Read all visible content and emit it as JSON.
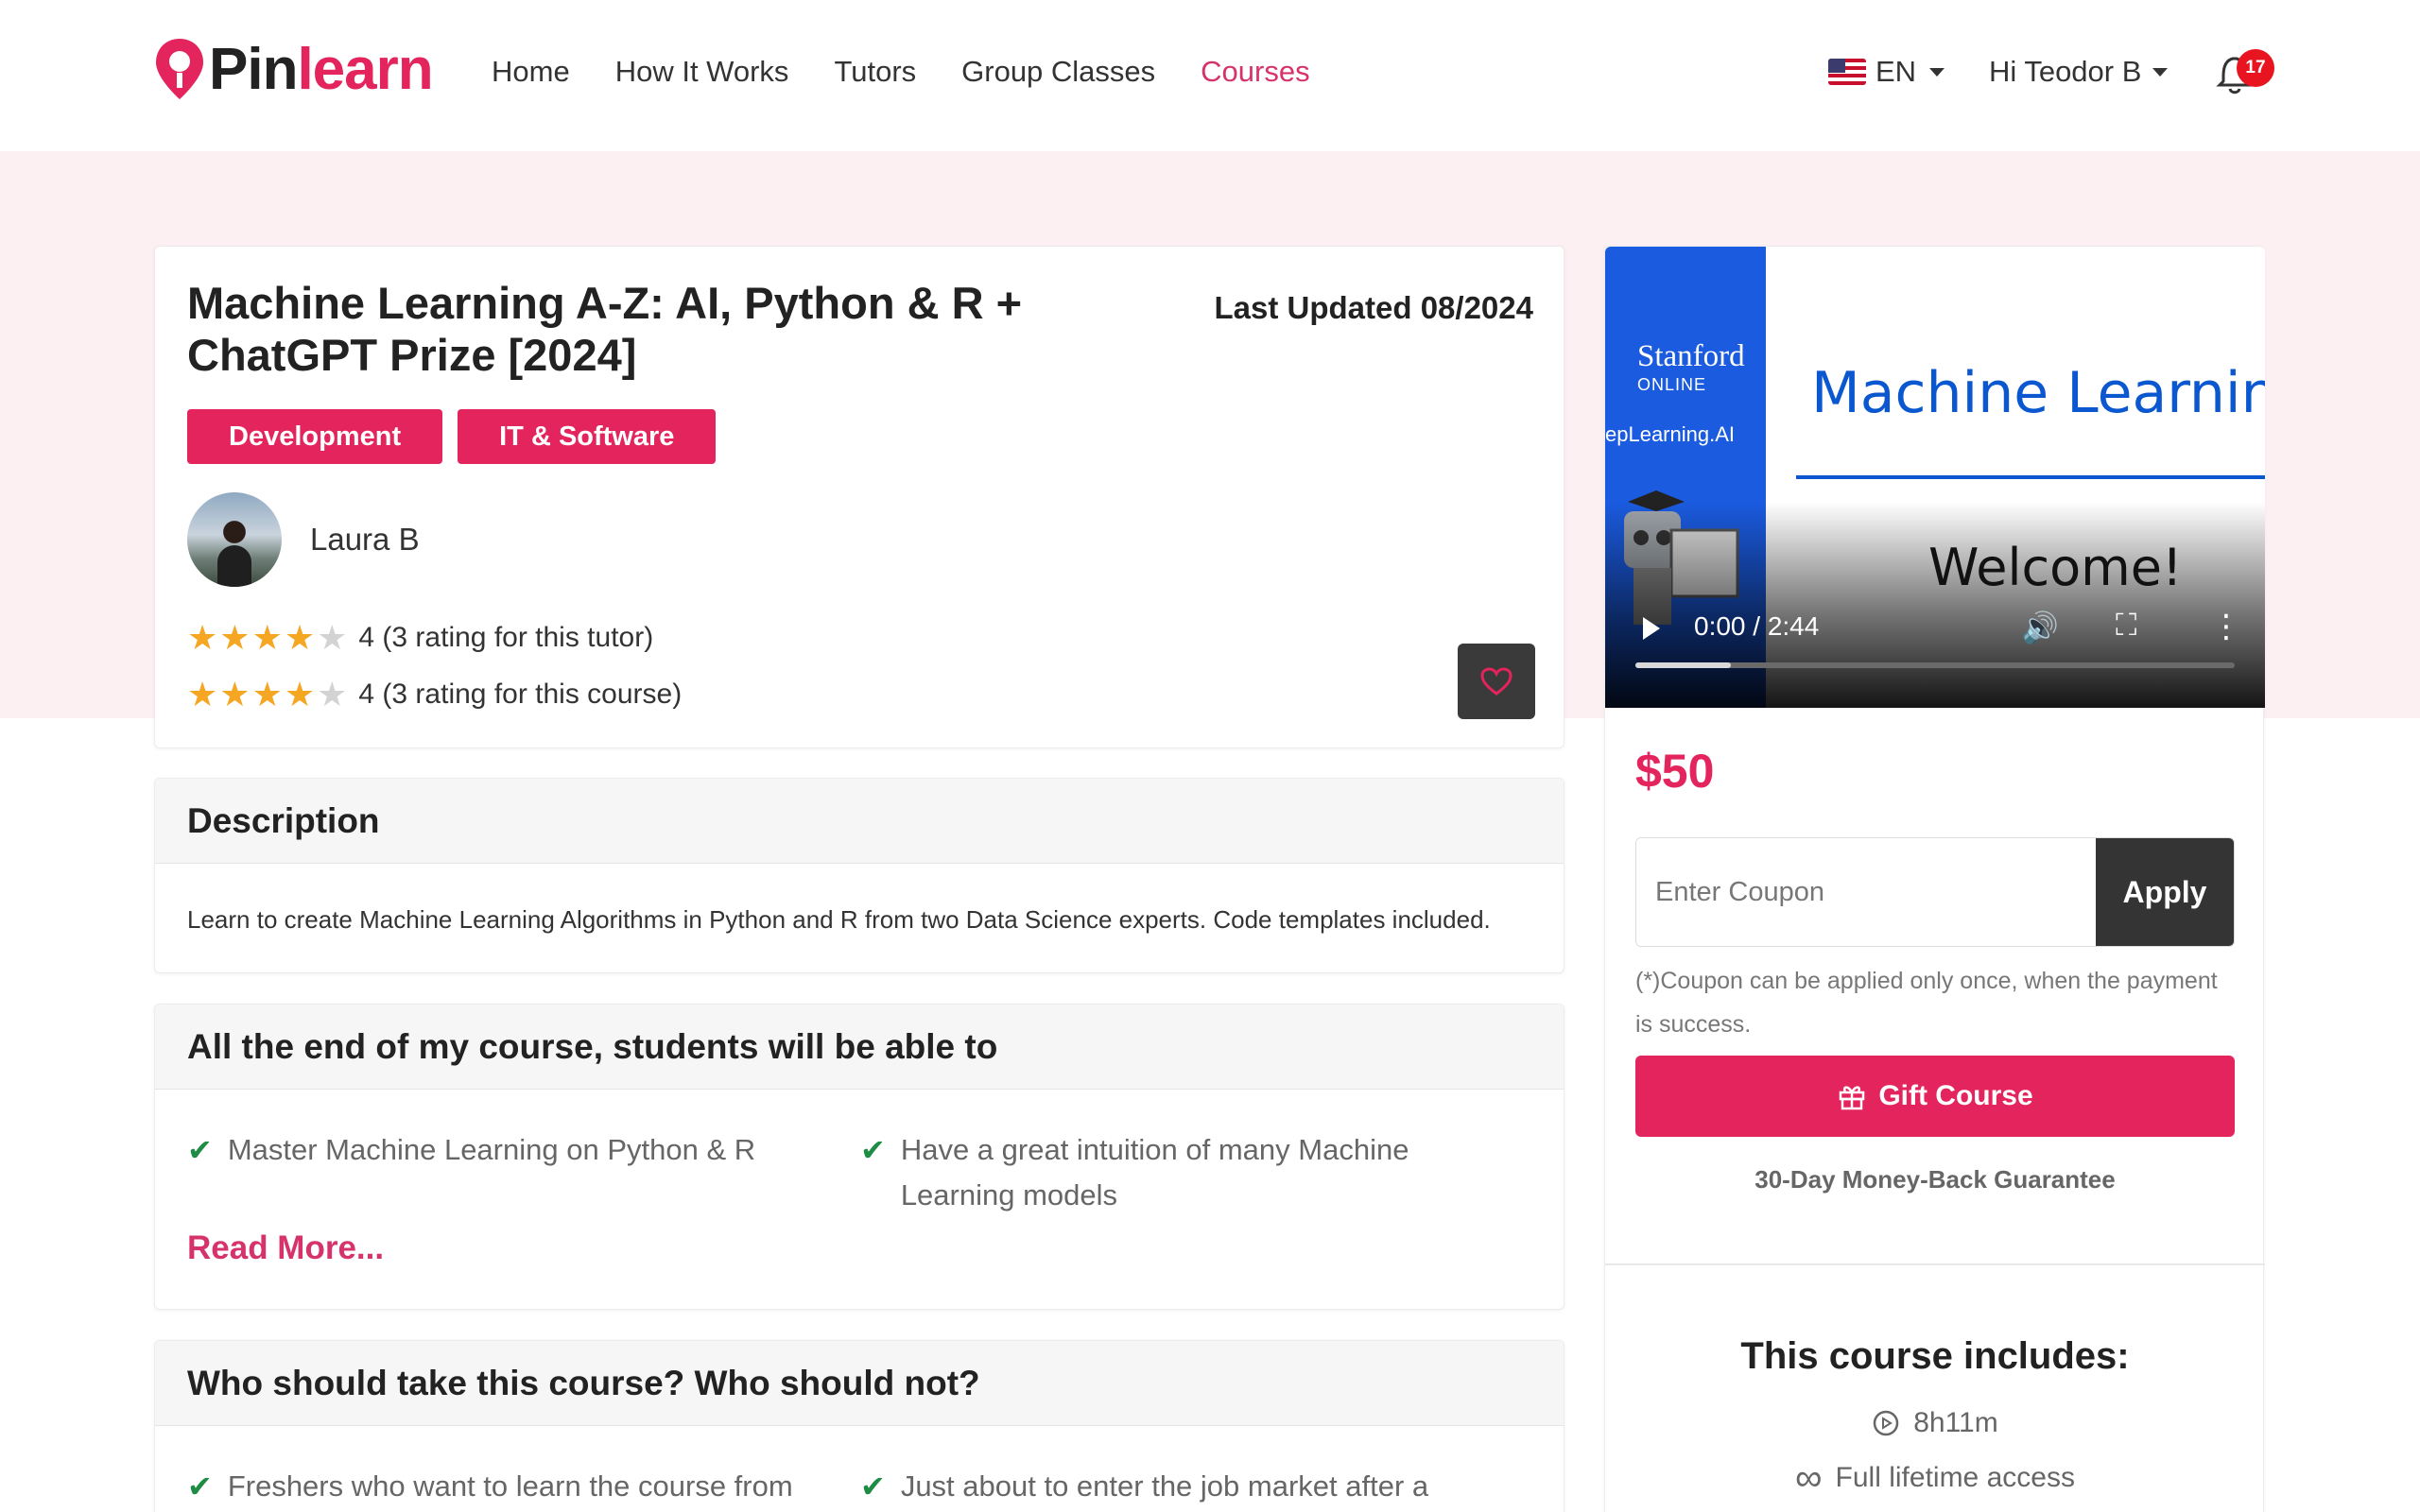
{
  "header": {
    "logo": {
      "text_main": "Pin",
      "text_accent": "learn"
    },
    "nav": [
      {
        "label": "Home"
      },
      {
        "label": "How It Works"
      },
      {
        "label": "Tutors"
      },
      {
        "label": "Group Classes"
      },
      {
        "label": "Courses",
        "active": true
      }
    ],
    "language": "EN",
    "user_greeting": "Hi Teodor B",
    "notifications_count": "17"
  },
  "course": {
    "title": "Machine Learning A-Z: AI, Python & R + ChatGPT Prize [2024]",
    "last_updated": "Last Updated 08/2024",
    "tags": [
      "Development",
      "IT & Software"
    ],
    "tutor_name": "Laura B",
    "tutor_rating": {
      "stars": 4,
      "text": "4 (3 rating for this tutor)"
    },
    "course_rating": {
      "stars": 4,
      "text": "4 (3 rating for this course)"
    }
  },
  "description": {
    "heading": "Description",
    "text": "Learn to create Machine Learning Algorithms in Python and R from two Data Science experts. Code templates included."
  },
  "outcomes": {
    "heading": "All the end of my course, students will be able to",
    "items": [
      "Master Machine Learning on Python & R",
      "Have a great intuition of many Machine Learning models"
    ],
    "read_more": "Read More..."
  },
  "audience": {
    "heading": "Who should take this course? Who should not?",
    "items": [
      "Freshers who want to learn the course from",
      "Just about to enter the job market after a"
    ]
  },
  "video": {
    "stanford": "Stanford",
    "online": "ONLINE",
    "deeplearning": "epLearning.AI",
    "title": "Machine Learning",
    "welcome": "Welcome!",
    "time": "0:00 / 2:44",
    "progress": 0.16
  },
  "purchase": {
    "price": "$50",
    "coupon_placeholder": "Enter Coupon",
    "apply_label": "Apply",
    "coupon_note": "(*)Coupon can be applied only once, when the payment is success.",
    "gift_label": "Gift Course",
    "guarantee": "30-Day Money-Back Guarantee"
  },
  "includes": {
    "heading": "This course includes:",
    "duration": "8h11m",
    "access": "Full lifetime access"
  },
  "colors": {
    "brand": "#e3245d",
    "active_nav": "#d6336c",
    "star": "#f5a623",
    "check": "#1e8c45"
  }
}
